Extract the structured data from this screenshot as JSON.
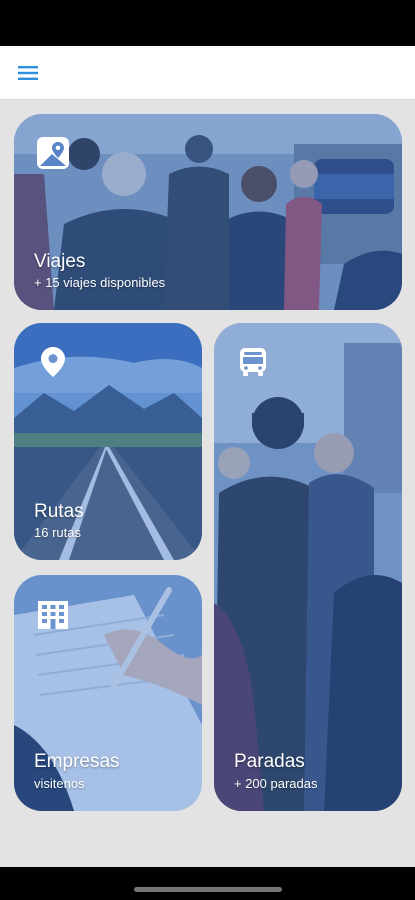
{
  "header": {
    "menu_icon": "hamburger-menu-icon",
    "accent_color": "#2f8fe0"
  },
  "cards": {
    "viajes": {
      "title": "Viajes",
      "subtitle": "+ 15 viajes disponibles",
      "icon": "map-photo-icon"
    },
    "rutas": {
      "title": "Rutas",
      "subtitle": "16 rutas",
      "icon": "location-pin-icon"
    },
    "empresas": {
      "title": "Empresas",
      "subtitle": "visitenos",
      "icon": "office-building-icon"
    },
    "paradas": {
      "title": "Paradas",
      "subtitle": "+ 200 paradas",
      "icon": "bus-icon"
    }
  },
  "colors": {
    "card_tint": "#346ec8",
    "background": "#e3e3e3"
  }
}
